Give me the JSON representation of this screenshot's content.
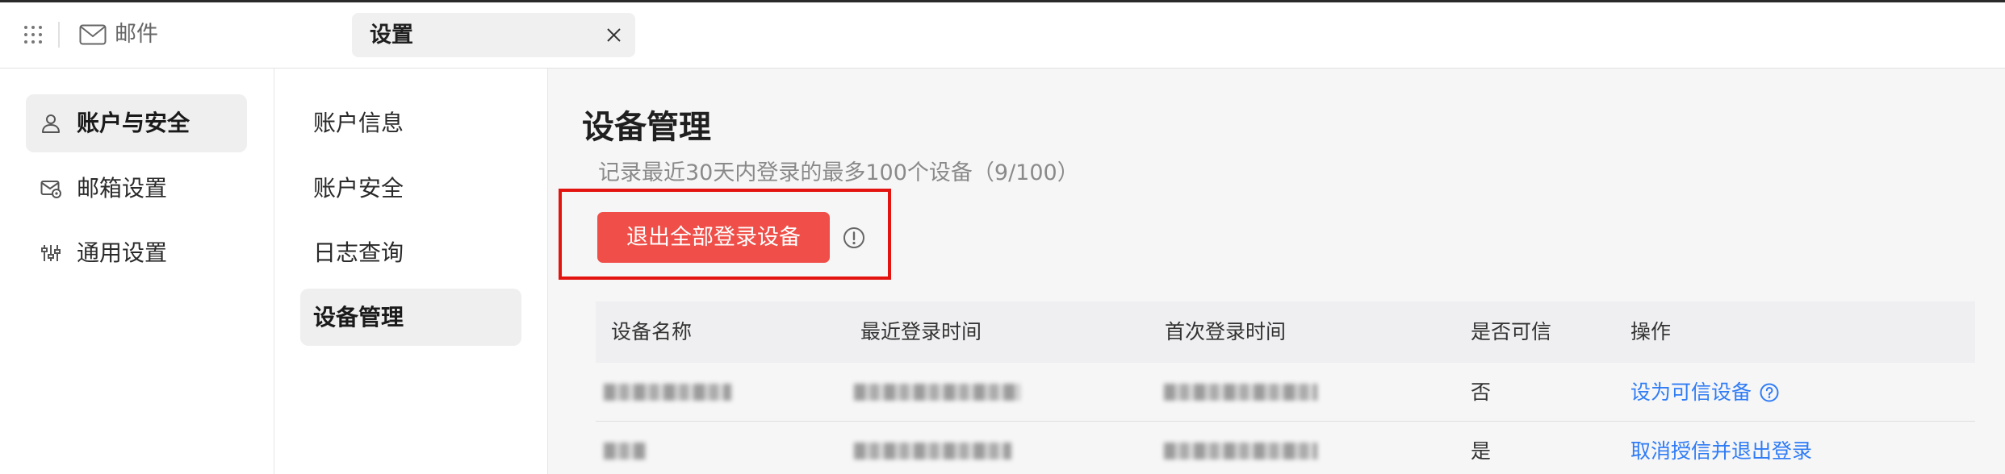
{
  "topbar": {
    "app_label": "邮件",
    "tab_label": "设置",
    "icons": {
      "apps": "grid-icon",
      "app": "mail-icon",
      "close": "close-icon"
    }
  },
  "sidebar": {
    "items": [
      {
        "label": "账户与安全",
        "icon": "user-icon",
        "selected": true
      },
      {
        "label": "邮箱设置",
        "icon": "mailbox-settings-icon",
        "selected": false
      },
      {
        "label": "通用设置",
        "icon": "sliders-icon",
        "selected": false
      }
    ]
  },
  "subnav": {
    "items": [
      {
        "label": "账户信息",
        "selected": false
      },
      {
        "label": "账户安全",
        "selected": false
      },
      {
        "label": "日志查询",
        "selected": false
      },
      {
        "label": "设备管理",
        "selected": true
      }
    ]
  },
  "main": {
    "title": "设备管理",
    "subtitle": "记录最近30天内登录的最多100个设备（9/100）",
    "logout_all_label": "退出全部登录设备",
    "info_icon": "info-icon"
  },
  "table": {
    "columns": [
      "设备名称",
      "最近登录时间",
      "首次登录时间",
      "是否可信",
      "操作"
    ],
    "rows": [
      {
        "trusted": "否",
        "action": "设为可信设备",
        "action_icon": "question-icon"
      },
      {
        "trusted": "是",
        "action": "取消授信并退出登录"
      }
    ]
  },
  "colors": {
    "accent": "#ef4f48",
    "link": "#2f7cf5",
    "highlight_border": "#e3140f"
  }
}
